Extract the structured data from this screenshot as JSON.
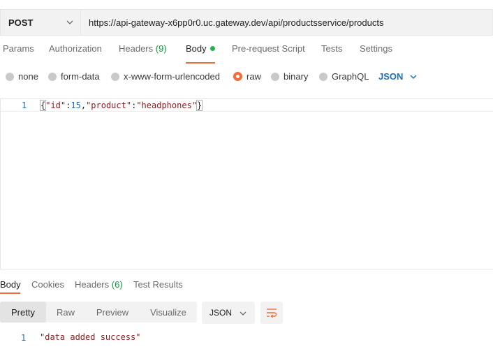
{
  "request": {
    "method": "POST",
    "url": "https://api-gateway-x6pp0r0.uc.gateway.dev/api/productsservice/products"
  },
  "request_tabs": {
    "params": "Params",
    "authorization": "Authorization",
    "headers_label": "Headers",
    "headers_count": "(9)",
    "body": "Body",
    "prerequest": "Pre-request Script",
    "tests": "Tests",
    "settings": "Settings"
  },
  "body_types": {
    "none": "none",
    "form_data": "form-data",
    "urlencoded": "x-www-form-urlencoded",
    "raw": "raw",
    "binary": "binary",
    "graphql": "GraphQL",
    "selected": "raw",
    "format": "JSON"
  },
  "editor": {
    "line_number": "1",
    "open_brace": "{",
    "key1": "\"id\"",
    "colon1": ":",
    "val1": "15",
    "comma": ",",
    "key2": "\"product\"",
    "colon2": ":",
    "val2": "\"headphones\"",
    "close_brace": "}"
  },
  "response_tabs": {
    "body": "Body",
    "cookies": "Cookies",
    "headers_label": "Headers",
    "headers_count": "(6)",
    "test_results": "Test Results"
  },
  "response_view": {
    "pretty": "Pretty",
    "raw": "Raw",
    "preview": "Preview",
    "visualize": "Visualize",
    "format": "JSON",
    "selected": "Pretty"
  },
  "response_body": {
    "line_number": "1",
    "text": "\"data added success\""
  },
  "colors": {
    "accent": "#f26b3a",
    "link_blue": "#1a6fb5",
    "count_green": "#0a9c3b",
    "status_dot": "#26b34a"
  }
}
